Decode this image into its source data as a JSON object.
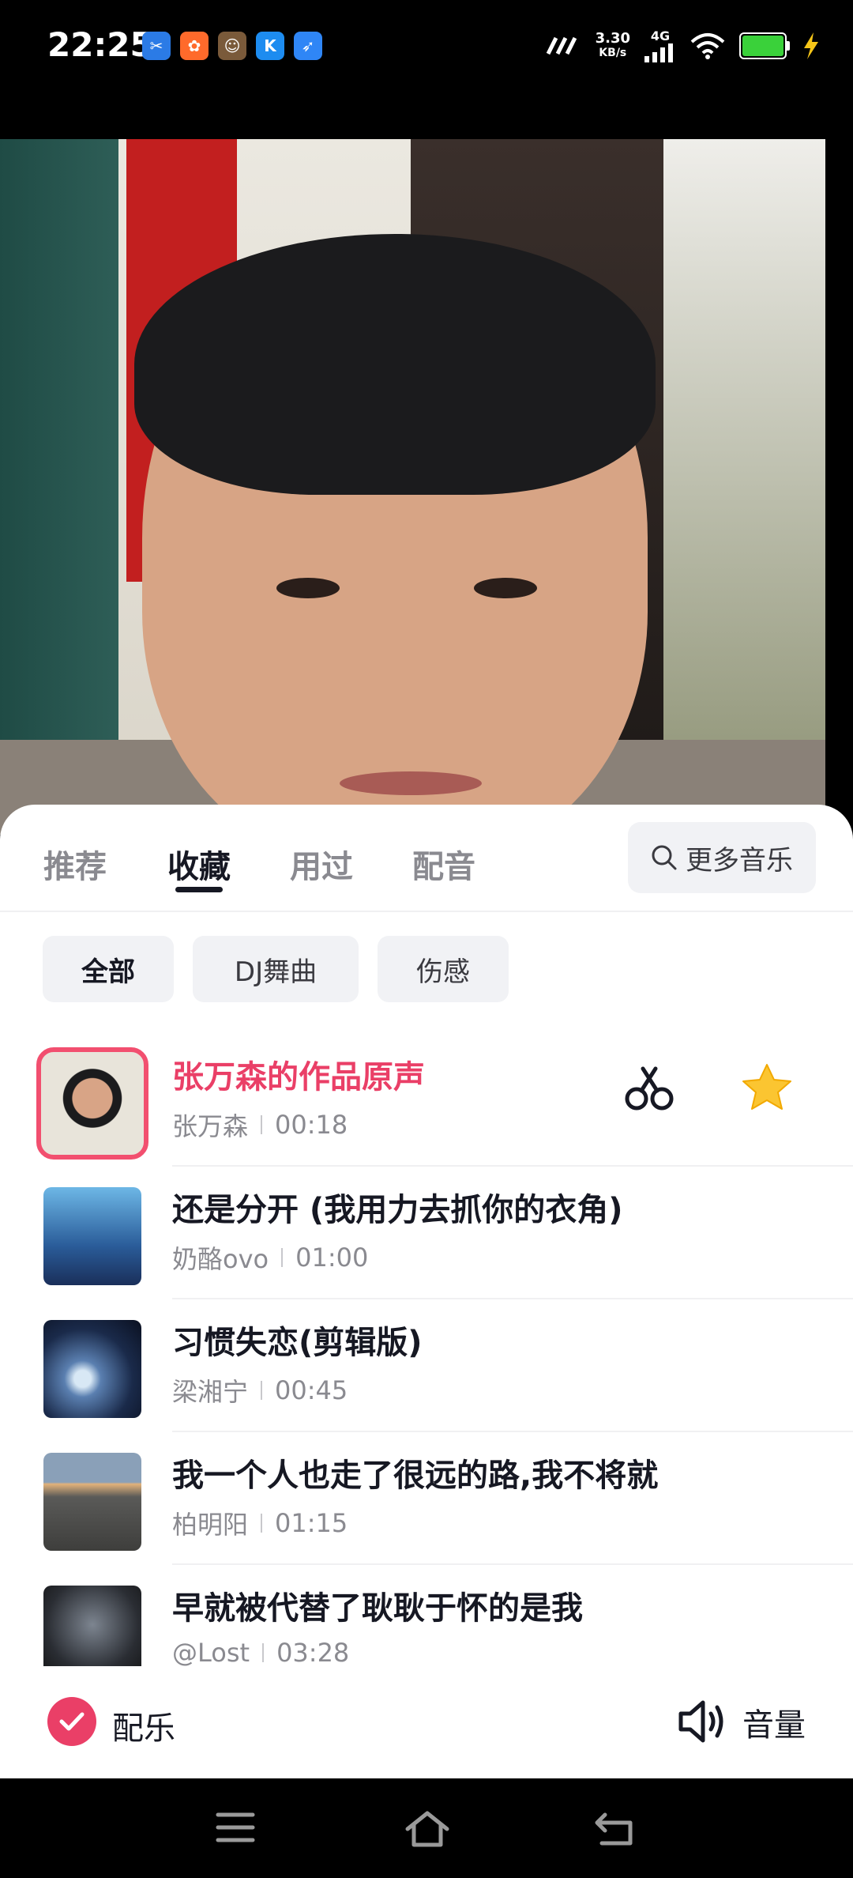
{
  "status": {
    "time": "22:25",
    "net_speed": "3.30",
    "net_unit": "KB/s",
    "network": "4G",
    "app_icons": [
      "scissors-app-icon",
      "app-icon-orange",
      "app-icon-photo",
      "kuaishou-icon",
      "feather-app-icon"
    ]
  },
  "tabs": [
    {
      "label": "推荐",
      "active": false
    },
    {
      "label": "收藏",
      "active": true
    },
    {
      "label": "用过",
      "active": false
    },
    {
      "label": "配音",
      "active": false
    }
  ],
  "more_music": "更多音乐",
  "chips": [
    {
      "label": "全部",
      "active": true
    },
    {
      "label": "DJ舞曲",
      "active": false
    },
    {
      "label": "伤感",
      "active": false
    }
  ],
  "songs": [
    {
      "title": "张万森的作品原声",
      "artist": "张万森",
      "duration": "00:18",
      "active": true
    },
    {
      "title": "还是分开 (我用力去抓你的衣角)",
      "artist": "奶酪ovo",
      "duration": "01:00",
      "active": false
    },
    {
      "title": "习惯失恋(剪辑版)",
      "artist": "梁湘宁",
      "duration": "00:45",
      "active": false
    },
    {
      "title": "我一个人也走了很远的路,我不将就",
      "artist": "柏明阳",
      "duration": "01:15",
      "active": false
    },
    {
      "title": "早就被代替了耿耿于怀的是我",
      "artist": "@Lost",
      "duration": "03:28",
      "active": false
    }
  ],
  "bottom": {
    "music_toggle": "配乐",
    "volume": "音量"
  },
  "colors": {
    "accent": "#ea3f67",
    "text_primary": "#161823",
    "text_secondary": "#8a8a90",
    "chip_bg": "#f1f2f5"
  }
}
